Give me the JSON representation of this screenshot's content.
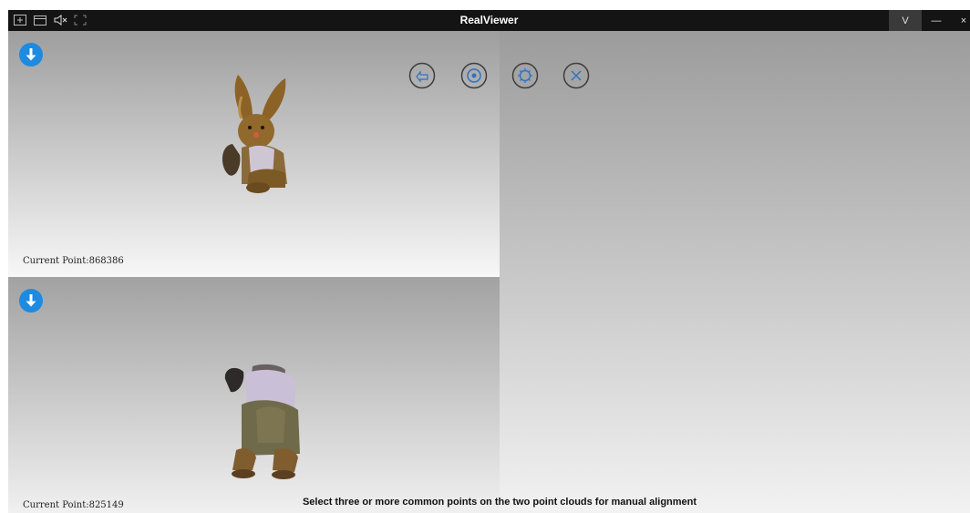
{
  "window": {
    "title": "RealViewer",
    "controls": {
      "v": "V",
      "minimize": "—",
      "close": "×"
    },
    "toolbar_icons": [
      "new-file-icon",
      "folder-icon",
      "mute-icon",
      "fullscreen-icon"
    ]
  },
  "views": {
    "top": {
      "current_point": "Current Point:868386"
    },
    "bottom": {
      "current_point": "Current Point:825149"
    }
  },
  "tools": [
    "back-icon",
    "target-icon",
    "settings-icon",
    "close-icon"
  ],
  "status_text": "Select three or more common points on the two point clouds for manual alignment",
  "colors": {
    "titlebar": "#141414",
    "accent": "#1e8ae0"
  }
}
